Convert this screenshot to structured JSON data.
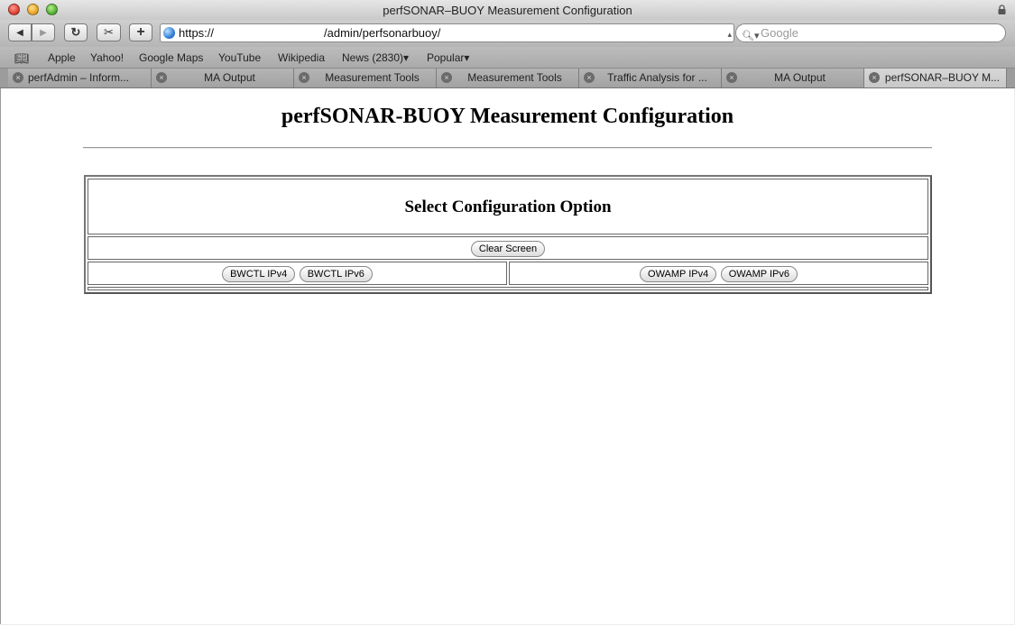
{
  "window": {
    "title": "perfSONAR–BUOY Measurement Configuration"
  },
  "toolbar": {
    "back_label": "◀",
    "forward_label": "▶",
    "reload_label": "↻",
    "snap_label": "✂",
    "add_label": "+",
    "url_prefix": "https://",
    "url_suffix": "/admin/perfsonarbuoy/",
    "search_placeholder": "Google"
  },
  "bookmarks": [
    "Apple",
    "Yahoo!",
    "Google Maps",
    "YouTube",
    "Wikipedia",
    "News (2830)▾",
    "Popular▾"
  ],
  "tabs": [
    {
      "label": "perfAdmin – Inform..."
    },
    {
      "label": "MA Output"
    },
    {
      "label": "Measurement Tools"
    },
    {
      "label": "Measurement Tools"
    },
    {
      "label": "Traffic Analysis for ..."
    },
    {
      "label": "MA Output"
    },
    {
      "label": "perfSONAR–BUOY M..."
    }
  ],
  "page": {
    "title": "perfSONAR-BUOY Measurement Configuration",
    "select_title": "Select Configuration Option",
    "clear_button": "Clear Screen",
    "bwctl_ipv4": "BWCTL IPv4",
    "bwctl_ipv6": "BWCTL IPv6",
    "owamp_ipv4": "OWAMP IPv4",
    "owamp_ipv6": "OWAMP IPv6"
  }
}
